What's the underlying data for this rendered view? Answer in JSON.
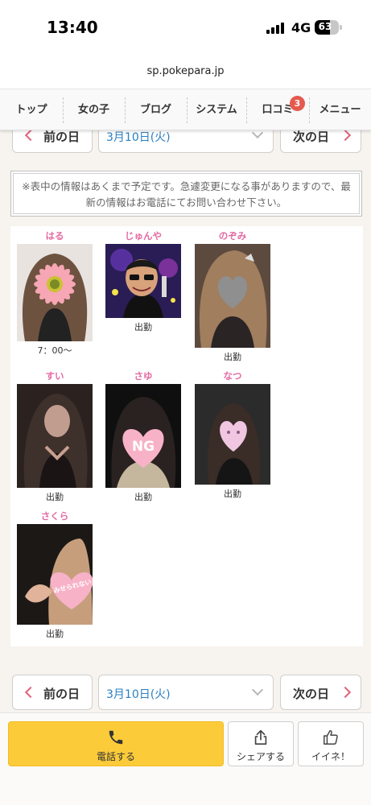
{
  "status_bar": {
    "time": "13:40",
    "network": "4G",
    "battery": "63",
    "battery_level": 0.63
  },
  "browser": {
    "url": "sp.pokepara.jp"
  },
  "nav": {
    "items": [
      {
        "label": "トップ"
      },
      {
        "label": "女の子"
      },
      {
        "label": "ブログ"
      },
      {
        "label": "システム"
      },
      {
        "label": "口コミ",
        "badge": "3"
      },
      {
        "label": "メニュー"
      }
    ]
  },
  "date_nav_top": {
    "prev_label": "前の日",
    "date_value": "3月10日(火)",
    "next_label": "次の日"
  },
  "notice": {
    "text": "※表中の情報はあくまで予定です。急遽変更になる事がありますので、最新の情報はお電話にてお問い合わせ下さい。"
  },
  "casts": [
    {
      "name": "はる",
      "status": "7：00〜"
    },
    {
      "name": "じゅんや",
      "status": "出勤"
    },
    {
      "name": "のぞみ",
      "status": "出勤"
    },
    {
      "name": "すい",
      "status": "出勤"
    },
    {
      "name": "さゆ",
      "status": "出勤"
    },
    {
      "name": "なつ",
      "status": "出勤"
    },
    {
      "name": "さくら",
      "status": "出勤"
    }
  ],
  "photo_stickers": {
    "sayu": "NG",
    "sakura": "みせられない"
  },
  "date_nav_bottom": {
    "prev_label": "前の日",
    "date_value": "3月10日(火)",
    "next_label": "次の日"
  },
  "bottom_bar": {
    "call_label": "電話する",
    "share_label": "シェアする",
    "like_label": "イイネ！"
  },
  "colors": {
    "accent_pink": "#e46ba3",
    "chevron": "#e0627a",
    "date_blue": "#2a7fc4",
    "call_yellow": "#fccb3a",
    "badge_red": "#e55a4e"
  }
}
